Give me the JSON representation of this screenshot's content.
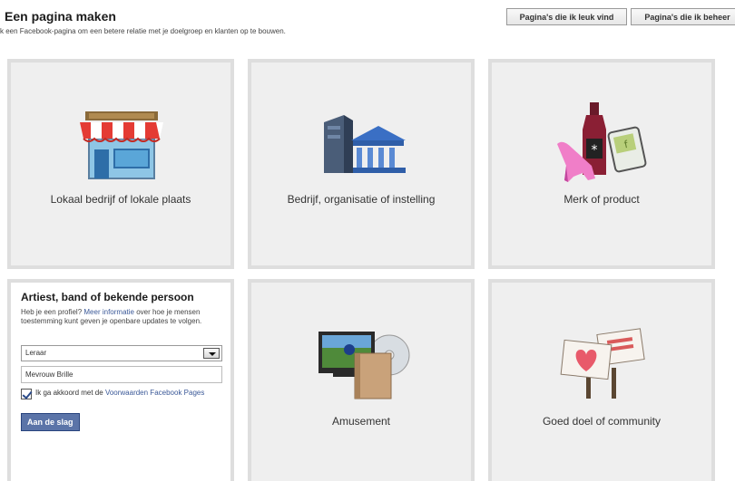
{
  "header": {
    "title": "Een pagina maken",
    "subtitle": "k een Facebook-pagina om een betere relatie met je doelgroep en klanten op te bouwen.",
    "buttons": {
      "liked_pages": "Pagina's die ik leuk vind",
      "managed_pages": "Pagina's die ik beheer"
    }
  },
  "tiles": {
    "local": {
      "label": "Lokaal bedrijf of lokale plaats",
      "icon": "storefront-icon"
    },
    "company": {
      "label": "Bedrijf, organisatie of instelling",
      "icon": "buildings-icon"
    },
    "brand": {
      "label": "Merk of product",
      "icon": "products-icon"
    },
    "entertainment": {
      "label": "Amusement",
      "icon": "media-icon"
    },
    "cause": {
      "label": "Goed doel of community",
      "icon": "signs-icon"
    }
  },
  "artist_form": {
    "title": "Artiest, band of bekende persoon",
    "desc_before": "Heb je een profiel? ",
    "desc_link": "Meer informatie",
    "desc_after": " over hoe je mensen toestemming kunt geven je openbare updates te volgen.",
    "category_value": "Leraar",
    "name_value": "Mevrouw Brille",
    "agree_before": "Ik ga akkoord met de ",
    "agree_link": "Voorwaarden Facebook Pages",
    "checkbox_checked": true,
    "submit_label": "Aan de slag"
  },
  "colors": {
    "link": "#3b5998",
    "button": "#5b74a8",
    "tile_bg": "#efefef"
  }
}
